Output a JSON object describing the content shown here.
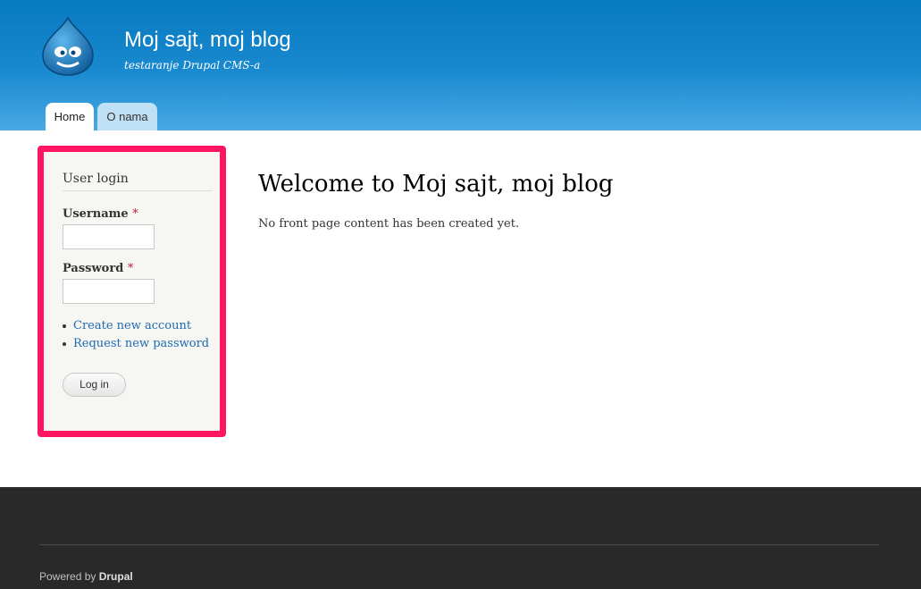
{
  "site": {
    "name": "Moj sajt, moj blog",
    "slogan": "testaranje Drupal CMS-a"
  },
  "nav": {
    "tabs": [
      {
        "label": "Home"
      },
      {
        "label": "O nama"
      }
    ]
  },
  "sidebar": {
    "block_title": "User login",
    "username_label": "Username",
    "password_label": "Password",
    "required_marker": "*",
    "links": [
      {
        "label": "Create new account"
      },
      {
        "label": "Request new password"
      }
    ],
    "login_button": "Log in"
  },
  "main": {
    "title": "Welcome to Moj sajt, moj blog",
    "text": "No front page content has been created yet."
  },
  "footer": {
    "powered_prefix": "Powered by",
    "powered_brand": "Drupal"
  },
  "colors": {
    "header_top": "#0779bf",
    "header_bottom": "#48a9e4",
    "highlight_frame": "#fe1662",
    "link": "#1d6bb3",
    "footer_bg": "#292929"
  },
  "icons": {
    "logo": "drupal-drop-logo"
  }
}
